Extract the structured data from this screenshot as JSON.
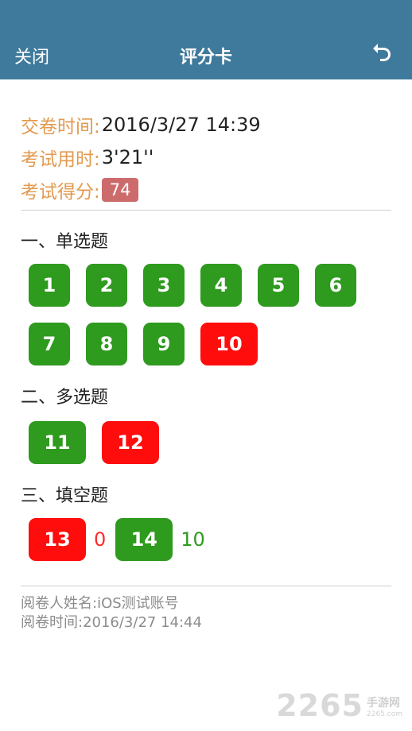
{
  "nav": {
    "close_label": "关闭",
    "title": "评分卡",
    "back_icon": "undo-icon"
  },
  "info": {
    "submit_time_label": "交卷时间:",
    "submit_time": "2016/3/27 14:39",
    "duration_label": "考试用时:",
    "duration": "3'21''",
    "score_label": "考试得分:",
    "score": "74"
  },
  "sections": {
    "single": {
      "title": "一、单选题"
    },
    "multi": {
      "title": "二、多选题"
    },
    "fill": {
      "title": "三、填空题"
    }
  },
  "questions": {
    "q1": "1",
    "q2": "2",
    "q3": "3",
    "q4": "4",
    "q5": "5",
    "q6": "6",
    "q7": "7",
    "q8": "8",
    "q9": "9",
    "q10": "10",
    "q11": "11",
    "q12": "12",
    "q13": "13",
    "q13_score": "0",
    "q14": "14",
    "q14_score": "10"
  },
  "footer": {
    "reviewer": "阅卷人姓名:iOS测试账号",
    "review_time": "阅卷时间:2016/3/27 14:44"
  },
  "watermark": {
    "number": "2265",
    "cn": "手游网",
    "en": "2265.com"
  },
  "colors": {
    "header": "#3f7a9c",
    "correct": "#2e9a1e",
    "wrong": "#ff0d0d",
    "label": "#e29a4f",
    "score_badge": "#cd6b6c"
  }
}
